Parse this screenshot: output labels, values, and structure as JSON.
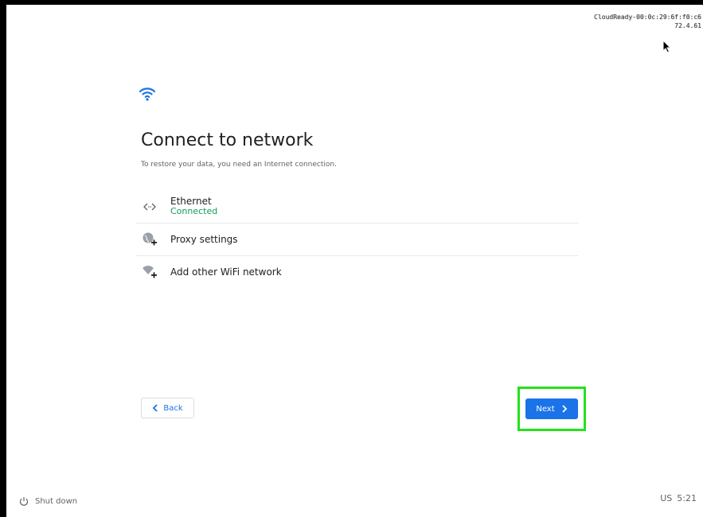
{
  "overlay": {
    "line1": "CloudReady-00:0c:29:6f:f0:c6",
    "line2": "72.4.61"
  },
  "header": {
    "icon": "wifi-icon",
    "title": "Connect to network",
    "subtitle": "To restore your data, you need an Internet connection."
  },
  "networks": [
    {
      "icon": "ethernet-icon",
      "label": "Ethernet",
      "status": "Connected"
    },
    {
      "icon": "proxy-globe-icon",
      "label": "Proxy settings"
    },
    {
      "icon": "add-wifi-icon",
      "label": "Add other WiFi network"
    }
  ],
  "buttons": {
    "back": "Back",
    "next": "Next"
  },
  "footer": {
    "shutdown": "Shut down",
    "locale": "US",
    "time": "5:21"
  },
  "colors": {
    "accent": "#1a73e8",
    "connected": "#0f9d58",
    "highlight": "#22e21a"
  }
}
